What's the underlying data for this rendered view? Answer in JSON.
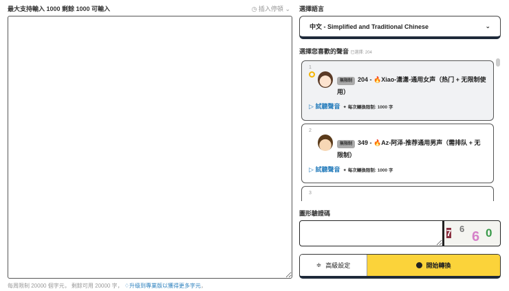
{
  "left": {
    "limit_label": "最大支持輸入 1000 剩餘 1000 可輸入",
    "insert_pause": "插入停頓",
    "text_value": "",
    "footer": {
      "quota": "每周限制 20000 個字元， 剩餘可用 20000 字，",
      "upgrade_link": "升级到專業版以獲得更多字元",
      "end": "，"
    }
  },
  "right": {
    "language_label": "選擇語言",
    "language_value": "中文 - Simplified and Traditional Chinese",
    "voice_label": "選擇您喜歡的聲音",
    "voice_selected": "已選擇: 204",
    "voices": [
      {
        "index": "1",
        "badge": "無限制",
        "title": "204 - 🔥Xiao-潇潇-通用女声（热门 + 无限制使用）",
        "play": "試聽聲音",
        "limit": "每次轉換限制: 1000 字",
        "selected": true
      },
      {
        "index": "2",
        "badge": "無限制",
        "title": "349 - 🔥Az-阿泽-推荐通用男声（需排队 + 无限制）",
        "play": "試聽聲音",
        "limit": "每次轉換限制: 1000 字",
        "selected": false
      },
      {
        "index": "3"
      }
    ],
    "captcha_label": "圖形驗證碼",
    "captcha_value": "",
    "captcha_chars": [
      "7",
      "6",
      "6",
      "0"
    ],
    "advanced_button": "高級設定",
    "start_button": "開始轉換"
  },
  "colors": {
    "accent": "#fbd33a",
    "link": "#2a7fbd",
    "selected_ring": "#f5b400"
  }
}
